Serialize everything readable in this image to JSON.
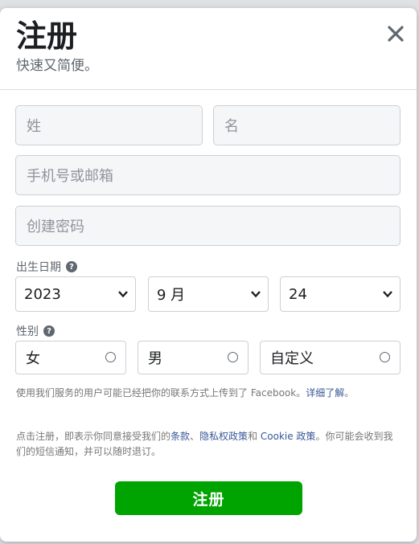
{
  "header": {
    "title": "注册",
    "subtitle": "快速又简便。"
  },
  "form": {
    "last_name_placeholder": "姓",
    "first_name_placeholder": "名",
    "contact_placeholder": "手机号或邮箱",
    "password_placeholder": "创建密码"
  },
  "birthday": {
    "label": "出生日期",
    "year": "2023",
    "month": "9 月",
    "day": "24"
  },
  "gender": {
    "label": "性别",
    "options": [
      "女",
      "男",
      "自定义"
    ]
  },
  "notice1": {
    "text": "使用我们服务的用户可能已经把你的联系方式上传到了 Facebook。",
    "link": "详细了解"
  },
  "notice2": {
    "prefix": "点击注册，即表示你同意接受我们的",
    "terms": "条款",
    "sep": "、",
    "privacy": "隐私权政策",
    "and": "和 ",
    "cookie": "Cookie 政策",
    "suffix": "。你可能会收到我们的短信通知，并可以随时退订。"
  },
  "submit_label": "注册",
  "icons": {
    "close": "close-icon",
    "help": "help-icon",
    "chevron": "chevron-down-icon",
    "radio": "radio-icon"
  },
  "colors": {
    "accent": "#00a400",
    "link": "#385898"
  }
}
